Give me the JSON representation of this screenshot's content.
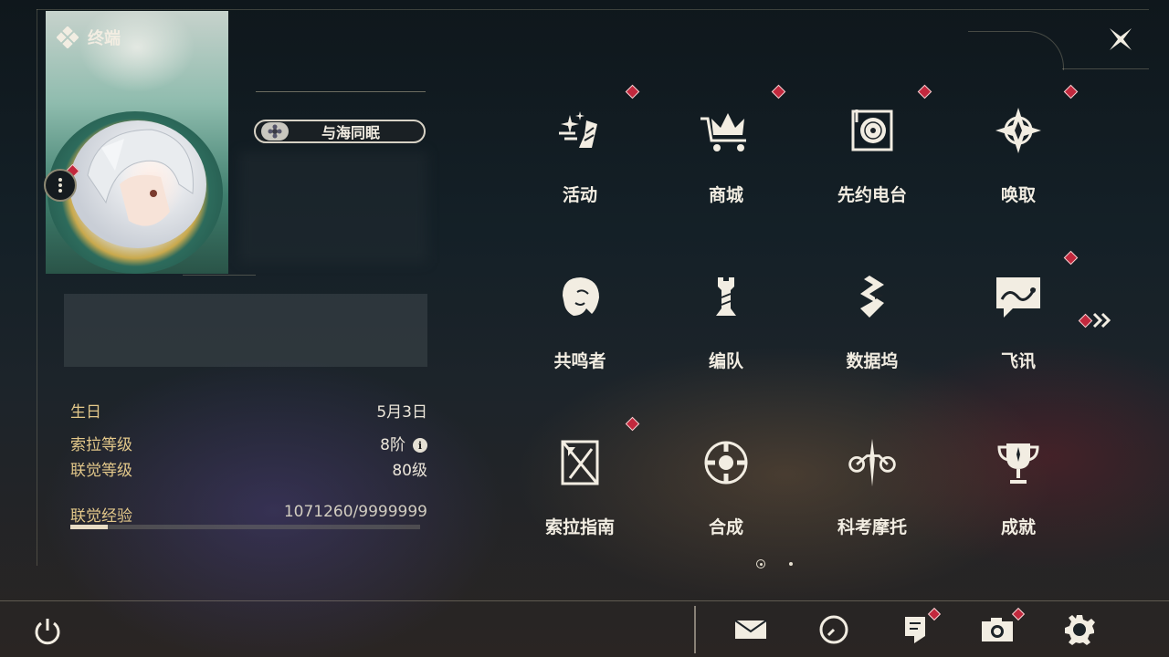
{
  "header": {
    "title": "终端"
  },
  "profile": {
    "name_badge": "与海同眠",
    "stats": [
      {
        "label": "生日",
        "value": "5月3日"
      },
      {
        "label": "索拉等级",
        "value": "8阶"
      },
      {
        "label": "联觉等级",
        "value": "80级"
      },
      {
        "label": "联觉经验",
        "value": "1071260/9999999"
      }
    ],
    "xp_fraction": 0.107
  },
  "menu": {
    "items": [
      {
        "label": "活动",
        "icon": "activity-icon",
        "badge": true
      },
      {
        "label": "商城",
        "icon": "crown-cart-icon",
        "badge": true
      },
      {
        "label": "先约电台",
        "icon": "radio-icon",
        "badge": true
      },
      {
        "label": "唤取",
        "icon": "compass-star-icon",
        "badge": true
      },
      {
        "label": "共鸣者",
        "icon": "resonator-icon",
        "badge": false
      },
      {
        "label": "编队",
        "icon": "chess-icon",
        "badge": false
      },
      {
        "label": "数据坞",
        "icon": "data-dock-icon",
        "badge": false
      },
      {
        "label": "飞讯",
        "icon": "chat-icon",
        "badge": true
      },
      {
        "label": "索拉指南",
        "icon": "guide-icon",
        "badge": true
      },
      {
        "label": "合成",
        "icon": "synthesis-icon",
        "badge": false
      },
      {
        "label": "科考摩托",
        "icon": "motorcycle-icon",
        "badge": false
      },
      {
        "label": "成就",
        "icon": "trophy-icon",
        "badge": false
      }
    ],
    "page_count": 2,
    "current_page": 1
  },
  "bottom_bar": [
    "mail-icon",
    "clock-icon",
    "notes-icon",
    "camera-icon",
    "settings-icon"
  ],
  "colors": {
    "accent_gold": "#e3c88a",
    "badge_red": "#c2283d",
    "text": "#ece6da"
  }
}
